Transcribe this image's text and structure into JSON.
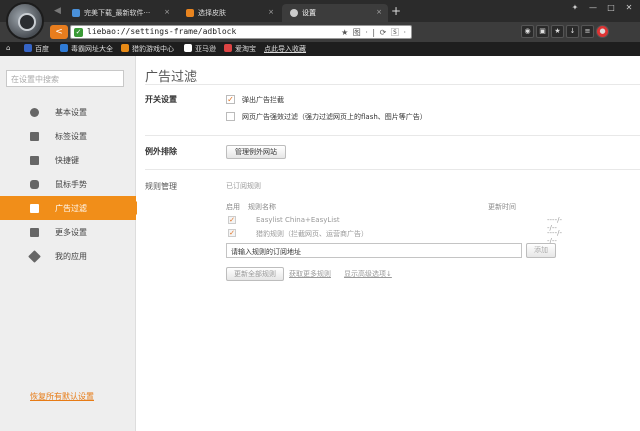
{
  "tabs": [
    {
      "label": "完美下载_最新软件···",
      "color": "#4a90d9"
    },
    {
      "label": "选择皮肤",
      "color": "#e8841f"
    },
    {
      "label": "设置",
      "color": "#cccccc"
    }
  ],
  "address": {
    "url": "liebao://settings-frame/adblock",
    "controls": "★ 图 · | ⟳ 🅂 ·"
  },
  "bookmarks": [
    "百度",
    "毒霸网址大全",
    "猎豹游戏中心",
    "亚马逊",
    "爱淘宝",
    "点此导入收藏"
  ],
  "sidebar": {
    "search_placeholder": "在设置中搜索",
    "items": [
      {
        "label": "基本设置"
      },
      {
        "label": "标签设置"
      },
      {
        "label": "快捷键"
      },
      {
        "label": "鼠标手势"
      },
      {
        "label": "广告过滤"
      },
      {
        "label": "更多设置"
      },
      {
        "label": "我的应用"
      }
    ],
    "reset_label": "恢复所有默认设置"
  },
  "main": {
    "title": "广告过滤",
    "switch": {
      "heading": "开关设置",
      "options": [
        {
          "label": "弹出广告拦截",
          "checked": true
        },
        {
          "label": "网页广告强效过滤（强力过滤网页上的flash、图片等广告）",
          "checked": false
        }
      ]
    },
    "exceptions": {
      "heading": "例外排除",
      "button": "管理例外网站"
    },
    "rules": {
      "heading": "规则管理",
      "subscribed_label": "已订阅规则",
      "columns": [
        "启用",
        "规则名称",
        "更新时间"
      ],
      "rows": [
        {
          "enabled": true,
          "name": "Easylist China+EasyList",
          "updated": "----/--/--"
        },
        {
          "enabled": true,
          "name": "猎豹规则（拦截网页、运营商广告）",
          "updated": "----/--/--"
        }
      ],
      "input_value": "请输入规则的订阅地址",
      "add_button": "添加",
      "update_all_button": "更新全部规则",
      "more_link": "获取更多规则",
      "advanced_link": "显示高级选项↓"
    }
  }
}
